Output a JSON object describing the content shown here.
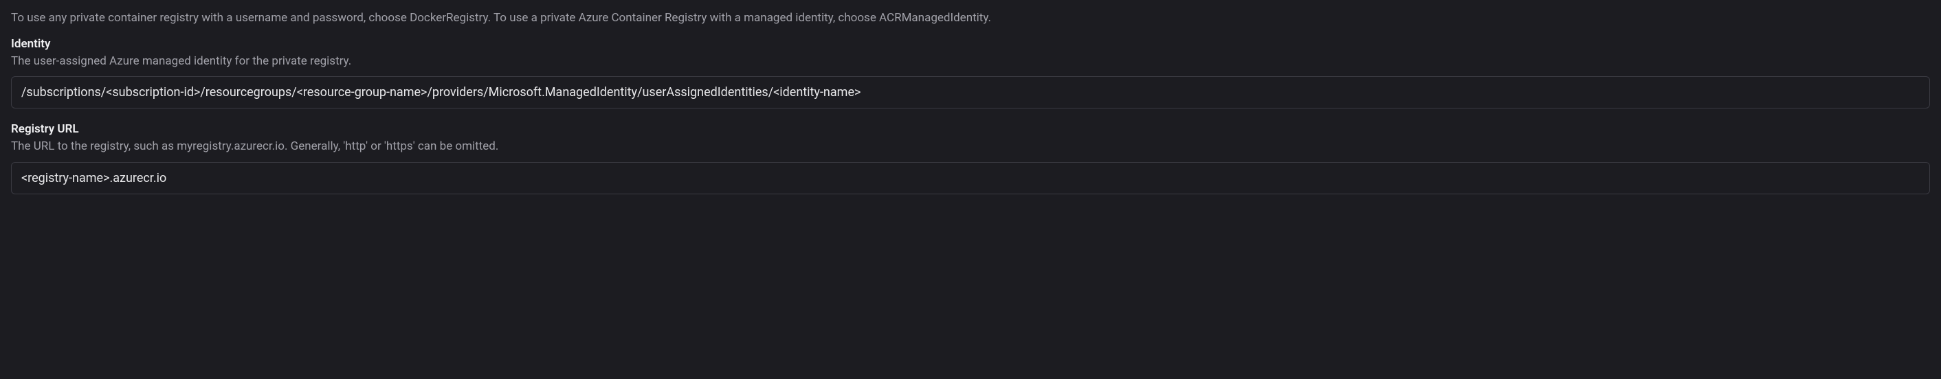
{
  "intro": "To use any private container registry with a username and password, choose DockerRegistry. To use a private Azure Container Registry with a managed identity, choose ACRManagedIdentity.",
  "fields": {
    "identity": {
      "label": "Identity",
      "description": "The user-assigned Azure managed identity for the private registry.",
      "value": "/subscriptions/<subscription-id>/resourcegroups/<resource-group-name>/providers/Microsoft.ManagedIdentity/userAssignedIdentities/<identity-name>"
    },
    "registryUrl": {
      "label": "Registry URL",
      "description": "The URL to the registry, such as myregistry.azurecr.io. Generally, 'http' or 'https' can be omitted.",
      "value": "<registry-name>.azurecr.io"
    }
  }
}
